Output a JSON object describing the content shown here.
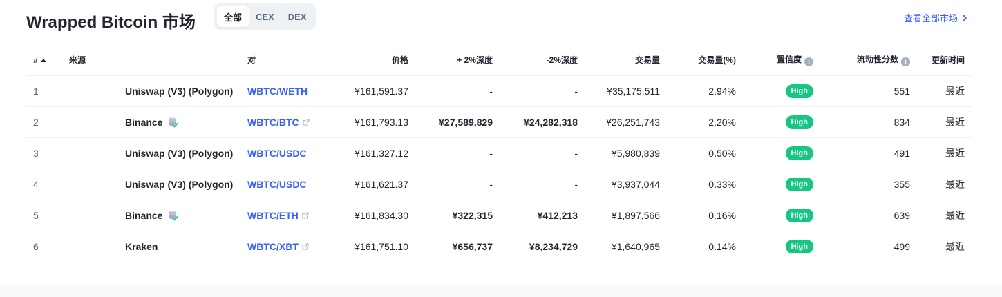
{
  "header": {
    "title": "Wrapped Bitcoin 市场",
    "filters": [
      {
        "label": "全部",
        "active": true
      },
      {
        "label": "CEX",
        "active": false
      },
      {
        "label": "DEX",
        "active": false
      }
    ],
    "view_all": "查看全部市场"
  },
  "table": {
    "columns": {
      "rank": "#",
      "source": "来源",
      "pair": "对",
      "price": "价格",
      "depth_plus": "+ 2%深度",
      "depth_minus": "-2%深度",
      "volume": "交易量",
      "volume_pct": "交易量(%)",
      "confidence": "置信度",
      "liquidity": "流动性分数",
      "updated": "更新时间"
    },
    "rows": [
      {
        "rank": "1",
        "source": "Uniswap (V3) (Polygon)",
        "cex": false,
        "pair": "WBTC/WETH",
        "external": false,
        "price": "¥161,591.37",
        "depth_plus": "-",
        "depth_minus": "-",
        "volume": "¥35,175,511",
        "volume_pct": "2.94%",
        "confidence": "High",
        "liquidity": "551",
        "updated": "最近"
      },
      {
        "rank": "2",
        "source": "Binance",
        "cex": true,
        "pair": "WBTC/BTC",
        "external": true,
        "price": "¥161,793.13",
        "depth_plus": "¥27,589,829",
        "depth_minus": "¥24,282,318",
        "volume": "¥26,251,743",
        "volume_pct": "2.20%",
        "confidence": "High",
        "liquidity": "834",
        "updated": "最近"
      },
      {
        "rank": "3",
        "source": "Uniswap (V3) (Polygon)",
        "cex": false,
        "pair": "WBTC/USDC",
        "external": false,
        "price": "¥161,327.12",
        "depth_plus": "-",
        "depth_minus": "-",
        "volume": "¥5,980,839",
        "volume_pct": "0.50%",
        "confidence": "High",
        "liquidity": "491",
        "updated": "最近"
      },
      {
        "rank": "4",
        "source": "Uniswap (V3) (Polygon)",
        "cex": false,
        "pair": "WBTC/USDC",
        "external": false,
        "price": "¥161,621.37",
        "depth_plus": "-",
        "depth_minus": "-",
        "volume": "¥3,937,044",
        "volume_pct": "0.33%",
        "confidence": "High",
        "liquidity": "355",
        "updated": "最近"
      },
      {
        "rank": "5",
        "source": "Binance",
        "cex": true,
        "pair": "WBTC/ETH",
        "external": true,
        "price": "¥161,834.30",
        "depth_plus": "¥322,315",
        "depth_minus": "¥412,213",
        "volume": "¥1,897,566",
        "volume_pct": "0.16%",
        "confidence": "High",
        "liquidity": "639",
        "updated": "最近"
      },
      {
        "rank": "6",
        "source": "Kraken",
        "cex": false,
        "pair": "WBTC/XBT",
        "external": true,
        "price": "¥161,751.10",
        "depth_plus": "¥656,737",
        "depth_minus": "¥8,234,729",
        "volume": "¥1,640,965",
        "volume_pct": "0.14%",
        "confidence": "High",
        "liquidity": "499",
        "updated": "最近"
      }
    ]
  },
  "colors": {
    "accent": "#3861fb",
    "confidence_high": "#16c784",
    "text": "#222531",
    "muted": "#58667e"
  },
  "icons": {
    "sort": "sort-ascending-icon",
    "info": "info-icon",
    "external": "external-link-icon",
    "cex": "verified-exchange-icon",
    "chevron": "chevron-right-icon"
  }
}
